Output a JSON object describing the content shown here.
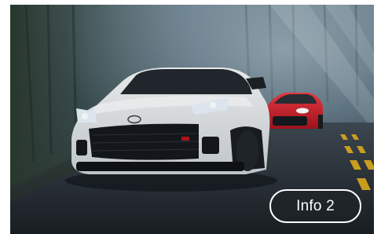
{
  "hero": {
    "accent_color": "#ffffff",
    "lead_car_color": "#e9ecee",
    "second_car_color": "#d8222f",
    "road_line_color": "#e6b21d"
  },
  "info_button": {
    "label": "Info 2"
  }
}
